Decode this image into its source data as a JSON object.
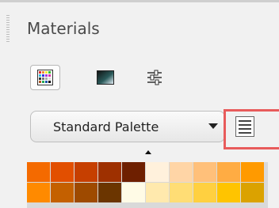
{
  "panel": {
    "title": "Materials",
    "mode_buttons": [
      {
        "icon": "grid-swatch-icon",
        "active": true
      },
      {
        "icon": "gradient-icon",
        "active": false
      },
      {
        "icon": "sliders-icon",
        "active": false
      }
    ],
    "palette_dropdown": {
      "selected": "Standard Palette",
      "icon": "chevron-down-icon"
    },
    "palette_menu_button": {
      "icon": "palette-menu-icon"
    },
    "swatch_rows": [
      [
        "#f46a00",
        "#e24f00",
        "#c63f00",
        "#9e3000",
        "#6e1f00",
        "#fff1dc",
        "#ffd5a6",
        "#ffc07a",
        "#ffac43",
        "#ff9a00"
      ],
      [
        "#ff8a00",
        "#c46000",
        "#9e4a00",
        "#6b3500",
        "#fffbe6",
        "#ffe9ad",
        "#ffdd75",
        "#ffd040",
        "#ffc400",
        "#dba200"
      ]
    ]
  }
}
